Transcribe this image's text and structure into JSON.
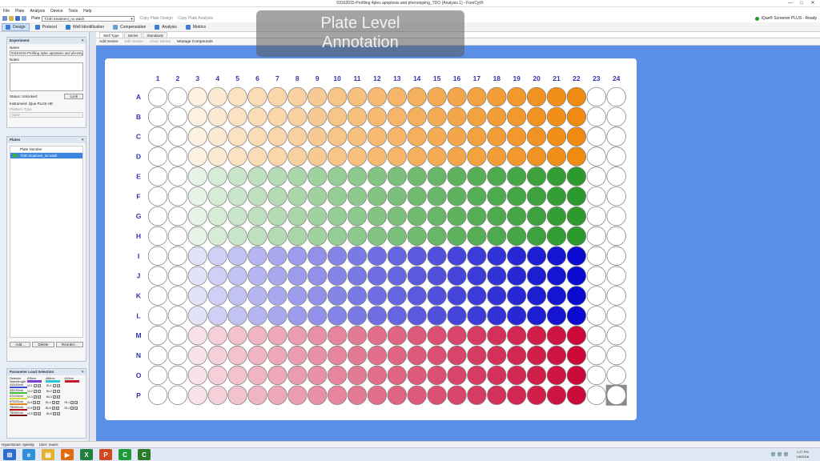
{
  "window": {
    "title": "03162015-Profiling 4plex apoptosis and phenotyping_TDO (Analysis 1) - ForeCyt®",
    "minimize": "—",
    "maximize": "□",
    "close": "✕"
  },
  "menu": [
    "File",
    "Plate",
    "Analysis",
    "Device",
    "Tools",
    "Help"
  ],
  "toolbar": {
    "plate_label": "Plate",
    "plate_value": "T24h treatment_no wash",
    "copy_plate_design": "Copy Plate Design",
    "copy_plate_analysis": "Copy Plate Analysis",
    "status": "iQue® Screener PLUS - Ready"
  },
  "ribbon": [
    {
      "label": "Design",
      "active": true,
      "icon_color": "#3c7bd6",
      "icon": "design-icon"
    },
    {
      "label": "Protocol",
      "active": false,
      "icon_color": "#3c7bd6",
      "icon": "protocol-icon"
    },
    {
      "label": "Well Identification",
      "active": false,
      "icon_color": "#2e7fd0",
      "icon": "well-id-icon"
    },
    {
      "label": "Compensation",
      "active": false,
      "icon_color": "#5fa0e0",
      "icon": "compensation-icon"
    },
    {
      "label": "Analysis",
      "active": false,
      "icon_color": "#3c7bd6",
      "icon": "analysis-icon"
    },
    {
      "label": "Metrics",
      "active": false,
      "icon_color": "#3c7bd6",
      "icon": "metrics-icon"
    }
  ],
  "overlay": {
    "line1": "Plate Level",
    "line2": "Annotation"
  },
  "experiment": {
    "header": "Experiment",
    "name_label": "Name",
    "name_value": "03162015-Profiling 4plex apoptosis and phenotyping_TDO",
    "notes_label": "Notes",
    "status_label": "Status: Unlocked",
    "lock_button": "Lock",
    "instrument": "Instrument: iQue PLUS HD",
    "platform_label": "Platform Type",
    "platform_value": "None"
  },
  "plates_panel": {
    "header": "Plates",
    "column_header": "Plate Number",
    "item": "T24h treatment_no wash",
    "add": "Add...",
    "delete": "Delete",
    "reorder": "Reorder..."
  },
  "parameter": {
    "header": "Parameter Load Selection",
    "detector_label": "Detector Wavelength",
    "lasers": [
      "405nm",
      "488nm",
      "640nm"
    ],
    "laser_colors": [
      "#7b3fd0",
      "#27c8d8",
      "#c21a2a"
    ],
    "rows": [
      {
        "band": "445/45nm",
        "color": "#3a50d8",
        "ch": [
          "VL1",
          "BL1"
        ]
      },
      {
        "band": "530/30nm",
        "color": "#3cc03c",
        "ch": [
          "VL2",
          "BL2"
        ]
      },
      {
        "band": "572/28nm",
        "color": "#d8d830",
        "ch": [
          "VL3",
          "BL3"
        ]
      },
      {
        "band": "675/25nm",
        "color": "#e08a20",
        "ch": [
          "VL4",
          "BL4",
          "RL1"
        ]
      },
      {
        "band": "780/60nm",
        "color": "#b01818",
        "ch": [
          "VL5",
          "BL5",
          "RL2"
        ]
      },
      {
        "band": "780/60nm",
        "color": "#7a1010",
        "ch": [
          "VL6",
          "BL6"
        ]
      }
    ]
  },
  "tabs": [
    "Well Type",
    "Series",
    "Standards"
  ],
  "subtoolbar": {
    "add_series": "Add Series",
    "edit_series": "Edit Series",
    "clear_series": "Clear Series",
    "manage_compounds": "Manage Compounds"
  },
  "plate": {
    "columns": [
      "1",
      "2",
      "3",
      "4",
      "5",
      "6",
      "7",
      "8",
      "9",
      "10",
      "11",
      "12",
      "13",
      "14",
      "15",
      "16",
      "17",
      "18",
      "19",
      "20",
      "21",
      "22",
      "23",
      "24"
    ],
    "rows": [
      "A",
      "B",
      "C",
      "D",
      "E",
      "F",
      "G",
      "H",
      "I",
      "J",
      "K",
      "L",
      "M",
      "N",
      "O",
      "P"
    ],
    "label_color": "#3333aa",
    "series": [
      {
        "rows": [
          "A",
          "B",
          "C",
          "D"
        ],
        "color": "#f08a10"
      },
      {
        "rows": [
          "E",
          "F",
          "G",
          "H"
        ],
        "color": "#2c9a2c"
      },
      {
        "rows": [
          "I",
          "J",
          "K",
          "L"
        ],
        "color": "#0a0ad0"
      },
      {
        "rows": [
          "M",
          "N",
          "O",
          "P"
        ],
        "color": "#cc0a3a"
      }
    ],
    "series_columns": [
      3,
      22
    ],
    "control_columns": [
      1,
      2,
      23,
      24
    ],
    "selected_well": "P24"
  },
  "statusbar": {
    "mode": "HyperStone: speedy",
    "user": "User: mavis"
  },
  "taskbar": {
    "apps": [
      {
        "name": "start-icon",
        "color": "#2e6cd0",
        "glyph": "⊞"
      },
      {
        "name": "ie-icon",
        "color": "#2f8fd8",
        "glyph": "e"
      },
      {
        "name": "explorer-icon",
        "color": "#e0b030",
        "glyph": "▤"
      },
      {
        "name": "media-icon",
        "color": "#e06a10",
        "glyph": "▶"
      },
      {
        "name": "excel-icon",
        "color": "#1e7e3a",
        "glyph": "X"
      },
      {
        "name": "ppt-icon",
        "color": "#d04820",
        "glyph": "P"
      },
      {
        "name": "forecyt-icon",
        "color": "#1a9a3a",
        "glyph": "C"
      },
      {
        "name": "forecyt2-icon",
        "color": "#2a7a2a",
        "glyph": "C"
      }
    ],
    "time": "1:27 PM",
    "date": "1/6/2016"
  }
}
